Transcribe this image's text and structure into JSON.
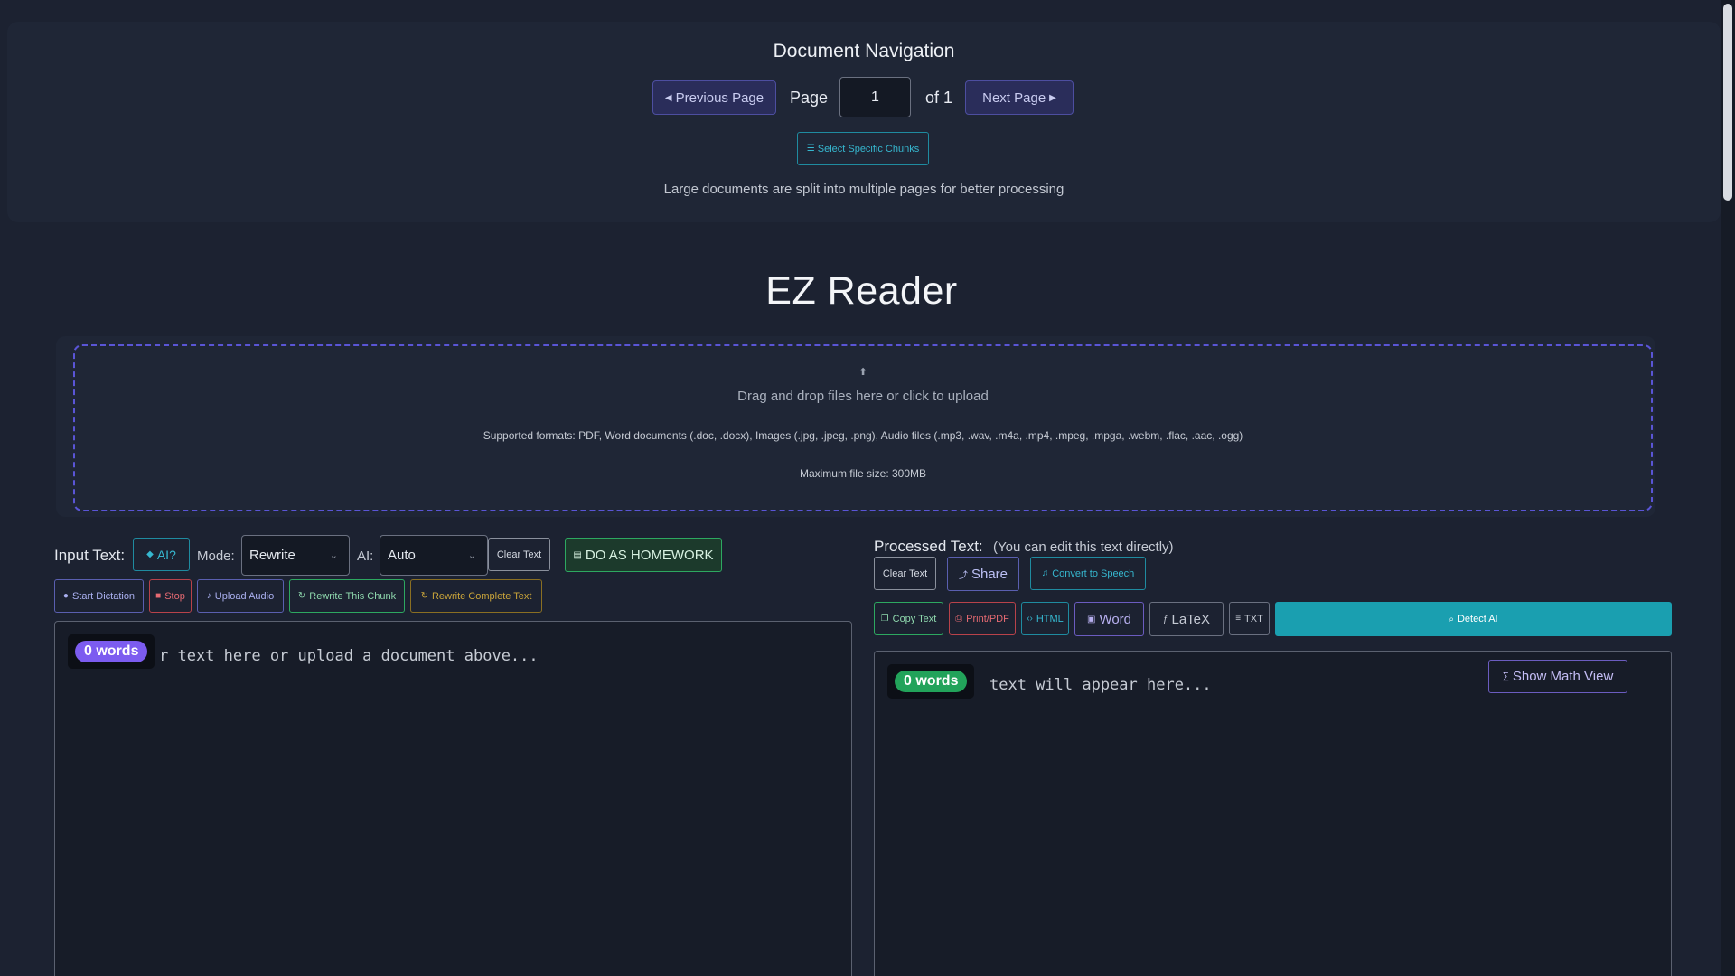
{
  "navigation": {
    "title": "Document Navigation",
    "prev_label": "Previous Page",
    "next_label": "Next Page",
    "page_label": "Page",
    "page_value": "1",
    "of_label": "of 1",
    "chunks_label": "Select Specific Chunks",
    "note": "Large documents are split into multiple pages for better processing"
  },
  "app": {
    "title": "EZ Reader"
  },
  "upload": {
    "main": "Drag and drop files here or click to upload",
    "formats": "Supported formats: PDF, Word documents (.doc, .docx), Images (.jpg, .jpeg, .png), Audio files (.mp3, .wav, .m4a, .mp4, .mpeg, .mpga, .webm, .flac, .aac, .ogg)",
    "max_size": "Maximum file size: 300MB"
  },
  "input": {
    "label": "Input Text:",
    "ai_check_label": "AI?",
    "mode_label": "Mode:",
    "mode_value": "Rewrite",
    "ai_label": "AI:",
    "ai_value": "Auto",
    "clear_label": "Clear Text",
    "homework_label": "DO AS HOMEWORK",
    "dictation_label": "Start Dictation",
    "stop_label": "Stop",
    "upload_audio_label": "Upload Audio",
    "rewrite_chunk_label": "Rewrite This Chunk",
    "rewrite_complete_label": "Rewrite Complete Text",
    "placeholder": "Enter your text here or upload a document above...",
    "placeholder_visible": "r text here or upload a document above...",
    "word_count": "0 words"
  },
  "output": {
    "label": "Processed Text:",
    "hint": "(You can edit this text directly)",
    "clear_label": "Clear Text",
    "share_label": "Share",
    "speech_label": "Convert to Speech",
    "copy_label": "Copy Text",
    "print_label": "Print/PDF",
    "html_label": "HTML",
    "word_label": "Word",
    "latex_label": "LaTeX",
    "txt_label": "TXT",
    "detect_label": "Detect AI",
    "math_view_label": "Show Math View",
    "placeholder_visible": "text will appear here...",
    "word_count": "0 words"
  },
  "colors": {
    "background": "#1c2231",
    "accent_purple": "#7c5cf0",
    "accent_green": "#22a35a",
    "accent_teal": "#1a9fb0"
  }
}
